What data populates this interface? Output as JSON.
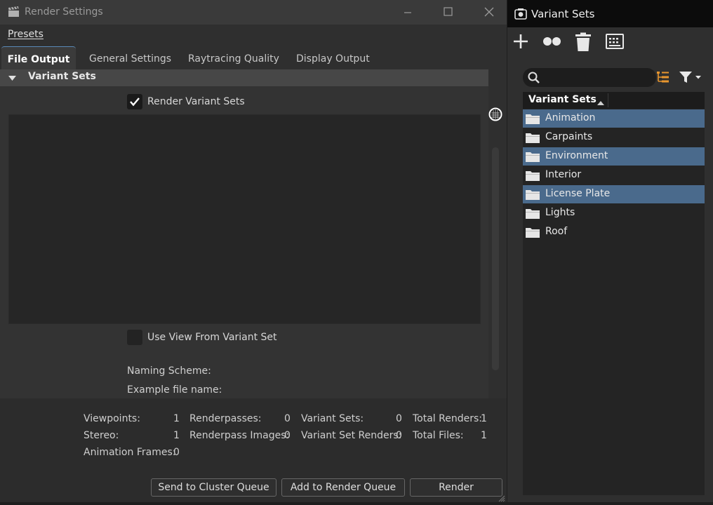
{
  "render_window": {
    "title": "Render Settings",
    "menu": {
      "presets": "Presets"
    },
    "tabs": [
      {
        "label": "File Output",
        "active": true
      },
      {
        "label": "General Settings",
        "active": false
      },
      {
        "label": "Raytracing Quality",
        "active": false
      },
      {
        "label": "Display Output",
        "active": false
      }
    ],
    "section": {
      "title": "Variant Sets",
      "expanded": true
    },
    "render_variant_sets": {
      "label": "Render Variant Sets",
      "checked": true
    },
    "use_view_from_variant_set": {
      "label": "Use View From Variant Set",
      "checked": false
    },
    "naming_scheme_label": "Naming Scheme:",
    "example_file_name_label": "Example file name:",
    "stats": {
      "viewpoints": {
        "label": "Viewpoints:",
        "value": "1"
      },
      "renderpasses": {
        "label": "Renderpasses:",
        "value": "0"
      },
      "variant_sets": {
        "label": "Variant Sets:",
        "value": "0"
      },
      "total_renders": {
        "label": "Total Renders:",
        "value": "1"
      },
      "stereo": {
        "label": "Stereo:",
        "value": "1"
      },
      "renderpass_images": {
        "label": "Renderpass Images:",
        "value": "0"
      },
      "variant_set_renders": {
        "label": "Variant Set Renders:",
        "value": "0"
      },
      "total_files": {
        "label": "Total Files:",
        "value": "1"
      },
      "animation_frames": {
        "label": "Animation Frames:",
        "value": "0"
      }
    },
    "buttons": {
      "send_to_cluster": "Send to Cluster Queue",
      "add_to_render_queue": "Add to Render Queue",
      "render": "Render"
    }
  },
  "variant_window": {
    "title": "Variant Sets",
    "toolbar_icons": [
      "add-icon",
      "variant-dots-icon",
      "trash-icon",
      "panel-icon"
    ],
    "search": {
      "value": "",
      "placeholder": ""
    },
    "tree_header": "Variant Sets",
    "items": [
      {
        "label": "Animation",
        "selected": true
      },
      {
        "label": "Carpaints",
        "selected": false
      },
      {
        "label": "Environment",
        "selected": true
      },
      {
        "label": "Interior",
        "selected": false
      },
      {
        "label": "License Plate",
        "selected": true
      },
      {
        "label": "Lights",
        "selected": false
      },
      {
        "label": "Roof",
        "selected": false
      }
    ]
  },
  "colors": {
    "selection": "#4a6a8c",
    "tab_accent": "#5a8ab8",
    "tree_icon_orange": "#e8962e"
  }
}
